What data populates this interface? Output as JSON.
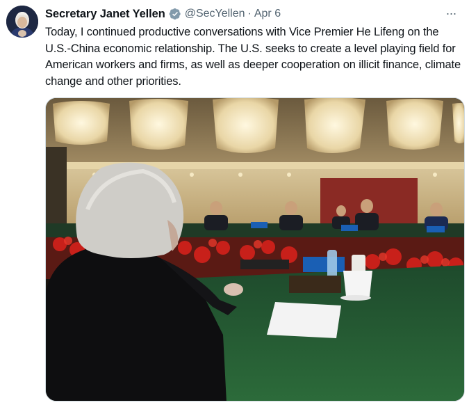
{
  "author": {
    "display_name": "Secretary Janet Yellen",
    "handle": "@SecYellen",
    "separator": "·",
    "date": "Apr 6",
    "verified_icon": "verified-badge-icon",
    "verified_color": "#829aab"
  },
  "tweet": {
    "text": "Today, I continued productive conversations with Vice Premier He Lifeng on the U.S.-China economic relationship. The U.S. seeks to create a level playing field for American workers and firms, as well as deeper cooperation on illicit finance, climate change and other priorities."
  },
  "more_button": {
    "label": "···",
    "icon": "more-options-icon"
  },
  "media": {
    "description_icon": "photo-bilateral-meeting"
  },
  "colors": {
    "text_primary": "#0f1419",
    "text_secondary": "#536471",
    "border": "#cfd9de"
  }
}
